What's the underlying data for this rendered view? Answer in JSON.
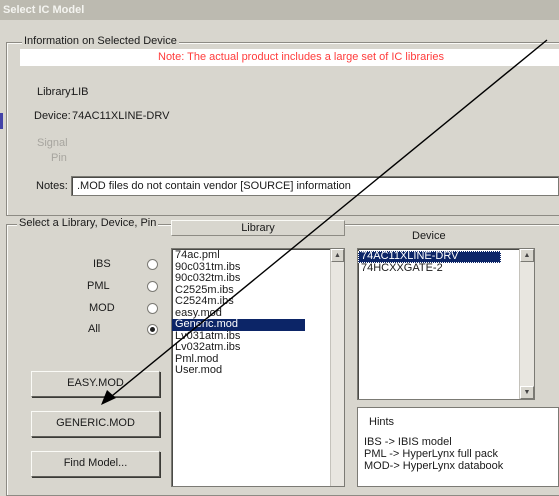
{
  "window": {
    "title": "Select IC Model"
  },
  "info": {
    "legend": "Information on Selected Device",
    "note": "Note: The actual product includes a large set of IC libraries",
    "library_label": "Library:",
    "library_value": "LIB",
    "device_label": "Device:",
    "device_value": "74AC11XLINE-DRV",
    "signal_label": "Signal",
    "pin_label": "Pin",
    "notes_label": "Notes:",
    "notes_value": ".MOD files do not contain vendor [SOURCE] information"
  },
  "select": {
    "legend": "Select a Library, Device, Pin",
    "filters": [
      {
        "label": "IBS",
        "checked": false
      },
      {
        "label": "PML",
        "checked": false
      },
      {
        "label": "MOD",
        "checked": false
      },
      {
        "label": "All",
        "checked": true
      }
    ],
    "library_header": "Library",
    "device_header": "Device",
    "libraries": [
      "74ac.pml",
      "90c031tm.ibs",
      "90c032tm.ibs",
      "C2525m.ibs",
      "C2524m.ibs",
      "easy.mod",
      "Generic.mod",
      "Lv031atm.ibs",
      "Lv032atm.ibs",
      "Pml.mod",
      "User.mod"
    ],
    "selected_library": "Generic.mod",
    "devices": [
      "74AC11XLINE-DRV",
      "74HCXXGATE-2"
    ],
    "selected_device": "74AC11XLINE-DRV",
    "buttons": {
      "easy": "EASY.MOD",
      "generic": "GENERIC.MOD",
      "find": "Find Model..."
    },
    "hints": {
      "legend": "Hints",
      "lines": [
        "IBS  -> IBIS model",
        "PML -> HyperLynx full pack",
        "MOD-> HyperLynx databook"
      ]
    }
  },
  "colors": {
    "note_text": "#ff3b3b",
    "selection": "#0c2567",
    "annotation_arrow": "#000000"
  }
}
